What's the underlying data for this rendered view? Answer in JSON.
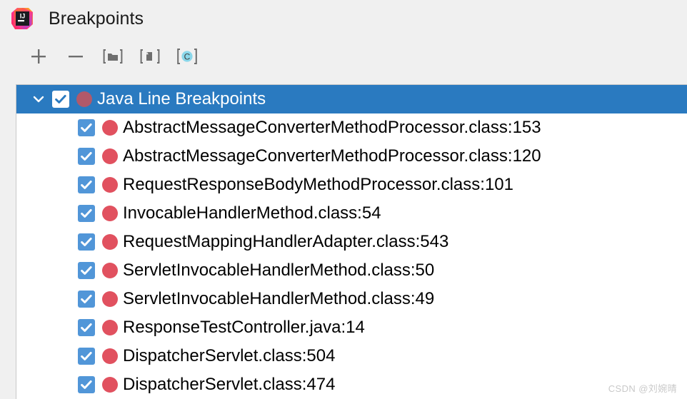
{
  "window": {
    "title": "Breakpoints",
    "logo_icon": "intellij-idea-logo",
    "logo_text": "IJ"
  },
  "colors": {
    "background": "#f0f0f0",
    "selection_blue": "#2a7ac0",
    "checkbox_blue": "#5196d8",
    "breakpoint_red": "#e1515f",
    "breakpoint_red_muted": "#b1596a",
    "toolbar_icon_gray": "#6e6e6e",
    "condition_cyan": "#8ad7ea"
  },
  "toolbar": {
    "buttons": [
      {
        "name": "add-breakpoint-button",
        "icon": "plus-icon",
        "label": "Add"
      },
      {
        "name": "remove-breakpoint-button",
        "icon": "minus-icon",
        "label": "Remove"
      },
      {
        "name": "group-breakpoints-button",
        "icon": "folder-bracket-icon",
        "label": "Move to group"
      },
      {
        "name": "save-breakpoint-button",
        "icon": "file-bracket-icon",
        "label": "Save to file"
      },
      {
        "name": "condition-button",
        "icon": "condition-c-icon",
        "label": "C"
      }
    ]
  },
  "tree": {
    "group": {
      "label": "Java Line Breakpoints",
      "expanded": true,
      "checked": true,
      "selected": true,
      "chevron_icon": "chevron-down-icon",
      "checkbox_icon": "checkbox-checked-icon",
      "dot_icon": "breakpoint-dot-icon"
    },
    "items": [
      {
        "label": "AbstractMessageConverterMethodProcessor.class:153",
        "checked": true
      },
      {
        "label": "AbstractMessageConverterMethodProcessor.class:120",
        "checked": true
      },
      {
        "label": "RequestResponseBodyMethodProcessor.class:101",
        "checked": true
      },
      {
        "label": "InvocableHandlerMethod.class:54",
        "checked": true
      },
      {
        "label": "RequestMappingHandlerAdapter.class:543",
        "checked": true
      },
      {
        "label": "ServletInvocableHandlerMethod.class:50",
        "checked": true
      },
      {
        "label": "ServletInvocableHandlerMethod.class:49",
        "checked": true
      },
      {
        "label": "ResponseTestController.java:14",
        "checked": true
      },
      {
        "label": "DispatcherServlet.class:504",
        "checked": true
      },
      {
        "label": "DispatcherServlet.class:474",
        "checked": true
      }
    ]
  },
  "watermark": {
    "text": "CSDN @刘婉晴"
  }
}
